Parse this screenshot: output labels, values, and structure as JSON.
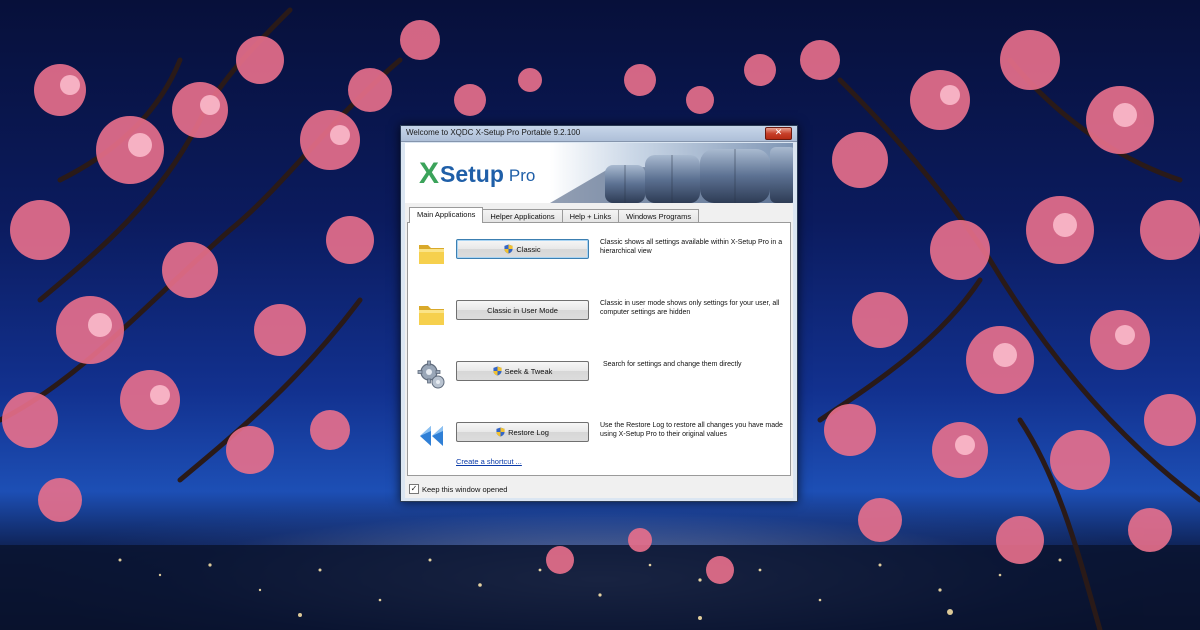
{
  "window": {
    "title": "Welcome to XQDC X-Setup Pro Portable 9.2.100",
    "close_label": "✕"
  },
  "banner": {
    "logo_x": "X",
    "logo_setup": "Setup",
    "logo_pro": "Pro"
  },
  "tabs": [
    {
      "label": "Main Applications",
      "active": true
    },
    {
      "label": "Helper Applications",
      "active": false
    },
    {
      "label": "Help + Links",
      "active": false
    },
    {
      "label": "Windows Programs",
      "active": false
    }
  ],
  "rows": [
    {
      "icon": "folder-icon",
      "button": "Classic",
      "description": "Classic shows all settings available within X-Setup Pro in a hierarchical view"
    },
    {
      "icon": "folder-icon",
      "button": "Classic in User Mode",
      "description": "Classic in user mode shows only settings for your user, all computer settings are hidden"
    },
    {
      "icon": "gears-icon",
      "button": "Seek & Tweak",
      "description": "Search for settings and change them directly"
    },
    {
      "icon": "rewind-icon",
      "button": "Restore Log",
      "description": "Use the Restore Log to restore all changes you have made using X-Setup Pro to their original values"
    }
  ],
  "shortcut_link": "Create a shortcut ...",
  "keep_open": {
    "label": "Keep this window opened",
    "checked": true
  },
  "colors": {
    "accent_green": "#3ba35a",
    "accent_blue": "#1f5fa8",
    "link": "#0a3aa8"
  }
}
